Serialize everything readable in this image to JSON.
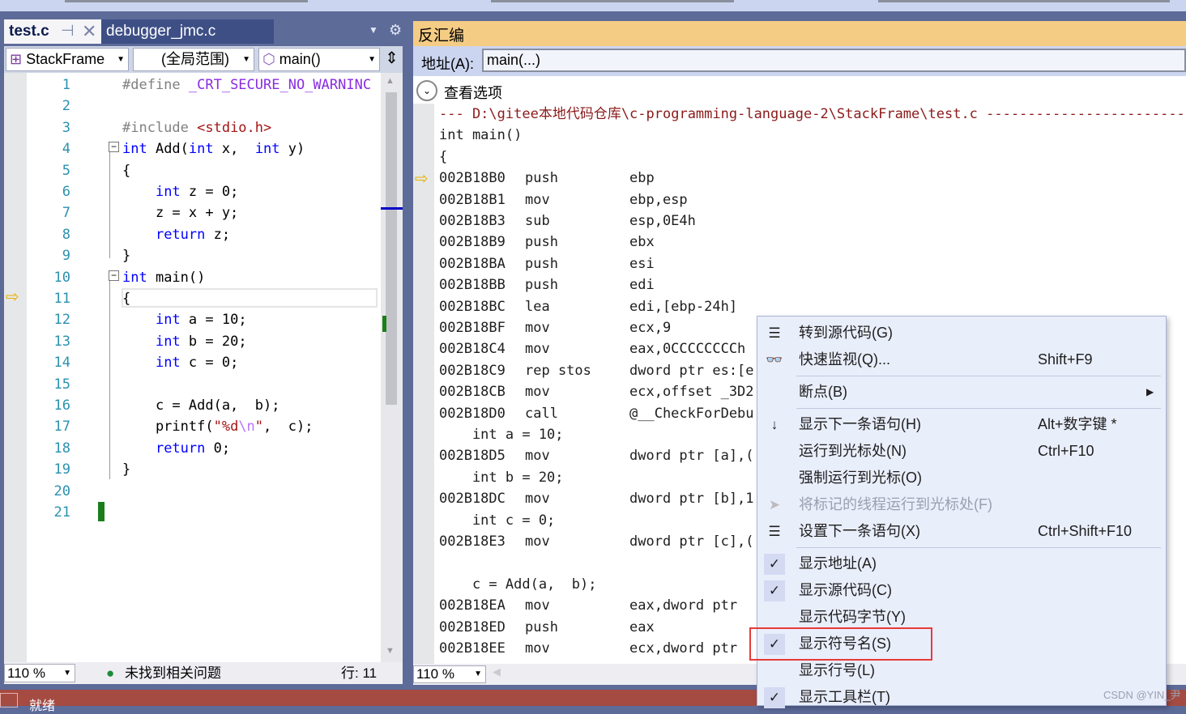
{
  "editor": {
    "tabs": [
      {
        "label": "test.c",
        "active": true
      },
      {
        "label": "debugger_jmc.c",
        "active": false
      }
    ],
    "nav": {
      "project": "StackFrame",
      "scope": "(全局范围)",
      "member": "main()"
    },
    "lines": [
      [
        [
          "pp",
          "#define "
        ],
        [
          "mac",
          "_CRT_SECURE_NO_WARNINC"
        ]
      ],
      [],
      [
        [
          "pp",
          "#include "
        ],
        [
          "str",
          "<stdio.h>"
        ]
      ],
      [
        [
          "kw",
          "int"
        ],
        [
          "t",
          " Add("
        ],
        [
          "kw",
          "int"
        ],
        [
          "t",
          " x,  "
        ],
        [
          "kw",
          "int"
        ],
        [
          "t",
          " y)"
        ]
      ],
      [
        [
          "t",
          "{"
        ]
      ],
      [
        [
          "t",
          "    "
        ],
        [
          "kw",
          "int"
        ],
        [
          "t",
          " z = 0;"
        ]
      ],
      [
        [
          "t",
          "    z = x + y;"
        ]
      ],
      [
        [
          "t",
          "    "
        ],
        [
          "kw",
          "return"
        ],
        [
          "t",
          " z;"
        ]
      ],
      [
        [
          "t",
          "}"
        ]
      ],
      [
        [
          "kw",
          "int"
        ],
        [
          "t",
          " main()"
        ]
      ],
      [
        [
          "t",
          "{"
        ]
      ],
      [
        [
          "t",
          "    "
        ],
        [
          "kw",
          "int"
        ],
        [
          "t",
          " a = 10;"
        ]
      ],
      [
        [
          "t",
          "    "
        ],
        [
          "kw",
          "int"
        ],
        [
          "t",
          " b = 20;"
        ]
      ],
      [
        [
          "t",
          "    "
        ],
        [
          "kw",
          "int"
        ],
        [
          "t",
          " c = 0;"
        ]
      ],
      [],
      [
        [
          "t",
          "    c = Add(a,  b);"
        ]
      ],
      [
        [
          "t",
          "    printf("
        ],
        [
          "str",
          "\"%d"
        ],
        [
          "esc",
          "\\n"
        ],
        [
          "str",
          "\""
        ],
        [
          "t",
          ",  c);"
        ]
      ],
      [
        [
          "t",
          "    "
        ],
        [
          "kw",
          "return"
        ],
        [
          "t",
          " 0;"
        ]
      ],
      [
        [
          "t",
          "}"
        ]
      ],
      [],
      []
    ],
    "zoom": "110 %",
    "issues": "未找到相关问题",
    "position": "行: 11"
  },
  "disasm": {
    "title": "反汇编",
    "address_label": "地址(A):",
    "address_value": "main(...)",
    "view_options": "查看选项",
    "lines": [
      {
        "t": "hdr",
        "text": "--- D:\\gitee本地代码仓库\\c-programming-language-2\\StackFrame\\test.c ------------------------"
      },
      {
        "t": "src",
        "text": "int main()"
      },
      {
        "t": "src",
        "text": "{"
      },
      {
        "t": "asm",
        "addr": "002B18B0",
        "op": "push",
        "arg": "ebp"
      },
      {
        "t": "asm",
        "addr": "002B18B1",
        "op": "mov",
        "arg": "ebp,esp"
      },
      {
        "t": "asm",
        "addr": "002B18B3",
        "op": "sub",
        "arg": "esp,0E4h"
      },
      {
        "t": "asm",
        "addr": "002B18B9",
        "op": "push",
        "arg": "ebx"
      },
      {
        "t": "asm",
        "addr": "002B18BA",
        "op": "push",
        "arg": "esi"
      },
      {
        "t": "asm",
        "addr": "002B18BB",
        "op": "push",
        "arg": "edi"
      },
      {
        "t": "asm",
        "addr": "002B18BC",
        "op": "lea",
        "arg": "edi,[ebp-24h]"
      },
      {
        "t": "asm",
        "addr": "002B18BF",
        "op": "mov",
        "arg": "ecx,9"
      },
      {
        "t": "asm",
        "addr": "002B18C4",
        "op": "mov",
        "arg": "eax,0CCCCCCCCh"
      },
      {
        "t": "asm",
        "addr": "002B18C9",
        "op": "rep stos",
        "arg": "dword ptr es:[e"
      },
      {
        "t": "asm",
        "addr": "002B18CB",
        "op": "mov",
        "arg": "ecx,offset _3D2"
      },
      {
        "t": "asm",
        "addr": "002B18D0",
        "op": "call",
        "arg": "@__CheckForDebu"
      },
      {
        "t": "src",
        "text": "    int a = 10;"
      },
      {
        "t": "asm",
        "addr": "002B18D5",
        "op": "mov",
        "arg": "dword ptr [a],("
      },
      {
        "t": "src",
        "text": "    int b = 20;"
      },
      {
        "t": "asm",
        "addr": "002B18DC",
        "op": "mov",
        "arg": "dword ptr [b],1"
      },
      {
        "t": "src",
        "text": "    int c = 0;"
      },
      {
        "t": "asm",
        "addr": "002B18E3",
        "op": "mov",
        "arg": "dword ptr [c],("
      },
      {
        "t": "src",
        "text": ""
      },
      {
        "t": "src",
        "text": "    c = Add(a,  b);"
      },
      {
        "t": "asm",
        "addr": "002B18EA",
        "op": "mov",
        "arg": "eax,dword ptr"
      },
      {
        "t": "asm",
        "addr": "002B18ED",
        "op": "push",
        "arg": "eax"
      },
      {
        "t": "asm",
        "addr": "002B18EE",
        "op": "mov",
        "arg": "ecx,dword ptr"
      }
    ],
    "zoom": "110 %"
  },
  "context_menu": {
    "items": [
      {
        "label": "转到源代码(G)",
        "icon": "goto-source-icon"
      },
      {
        "label": "快速监视(Q)...",
        "shortcut": "Shift+F9",
        "icon": "glasses-icon"
      },
      {
        "sep": true
      },
      {
        "label": "断点(B)",
        "submenu": true
      },
      {
        "sep": true
      },
      {
        "label": "显示下一条语句(H)",
        "shortcut": "Alt+数字键 *",
        "icon": "arrow-down-icon"
      },
      {
        "label": "运行到光标处(N)",
        "shortcut": "Ctrl+F10"
      },
      {
        "label": "强制运行到光标(O)"
      },
      {
        "label": "将标记的线程运行到光标处(F)",
        "disabled": true,
        "icon": "cursor-icon"
      },
      {
        "label": "设置下一条语句(X)",
        "shortcut": "Ctrl+Shift+F10",
        "icon": "set-next-icon"
      },
      {
        "sep": true
      },
      {
        "label": "显示地址(A)",
        "checked": true
      },
      {
        "label": "显示源代码(C)",
        "checked": true
      },
      {
        "label": "显示代码字节(Y)"
      },
      {
        "label": "显示符号名(S)",
        "checked": true,
        "highlighted": true
      },
      {
        "label": "显示行号(L)"
      },
      {
        "label": "显示工具栏(T)",
        "checked": true
      }
    ]
  },
  "statusbar": {
    "text": "就绪"
  },
  "watermark": "CSDN @YIN_尹",
  "colors": {
    "frame": "#5d6b99",
    "disasm_title": "#f5cc84",
    "status": "#a54b42",
    "highlight_box": "#e83a3a"
  }
}
